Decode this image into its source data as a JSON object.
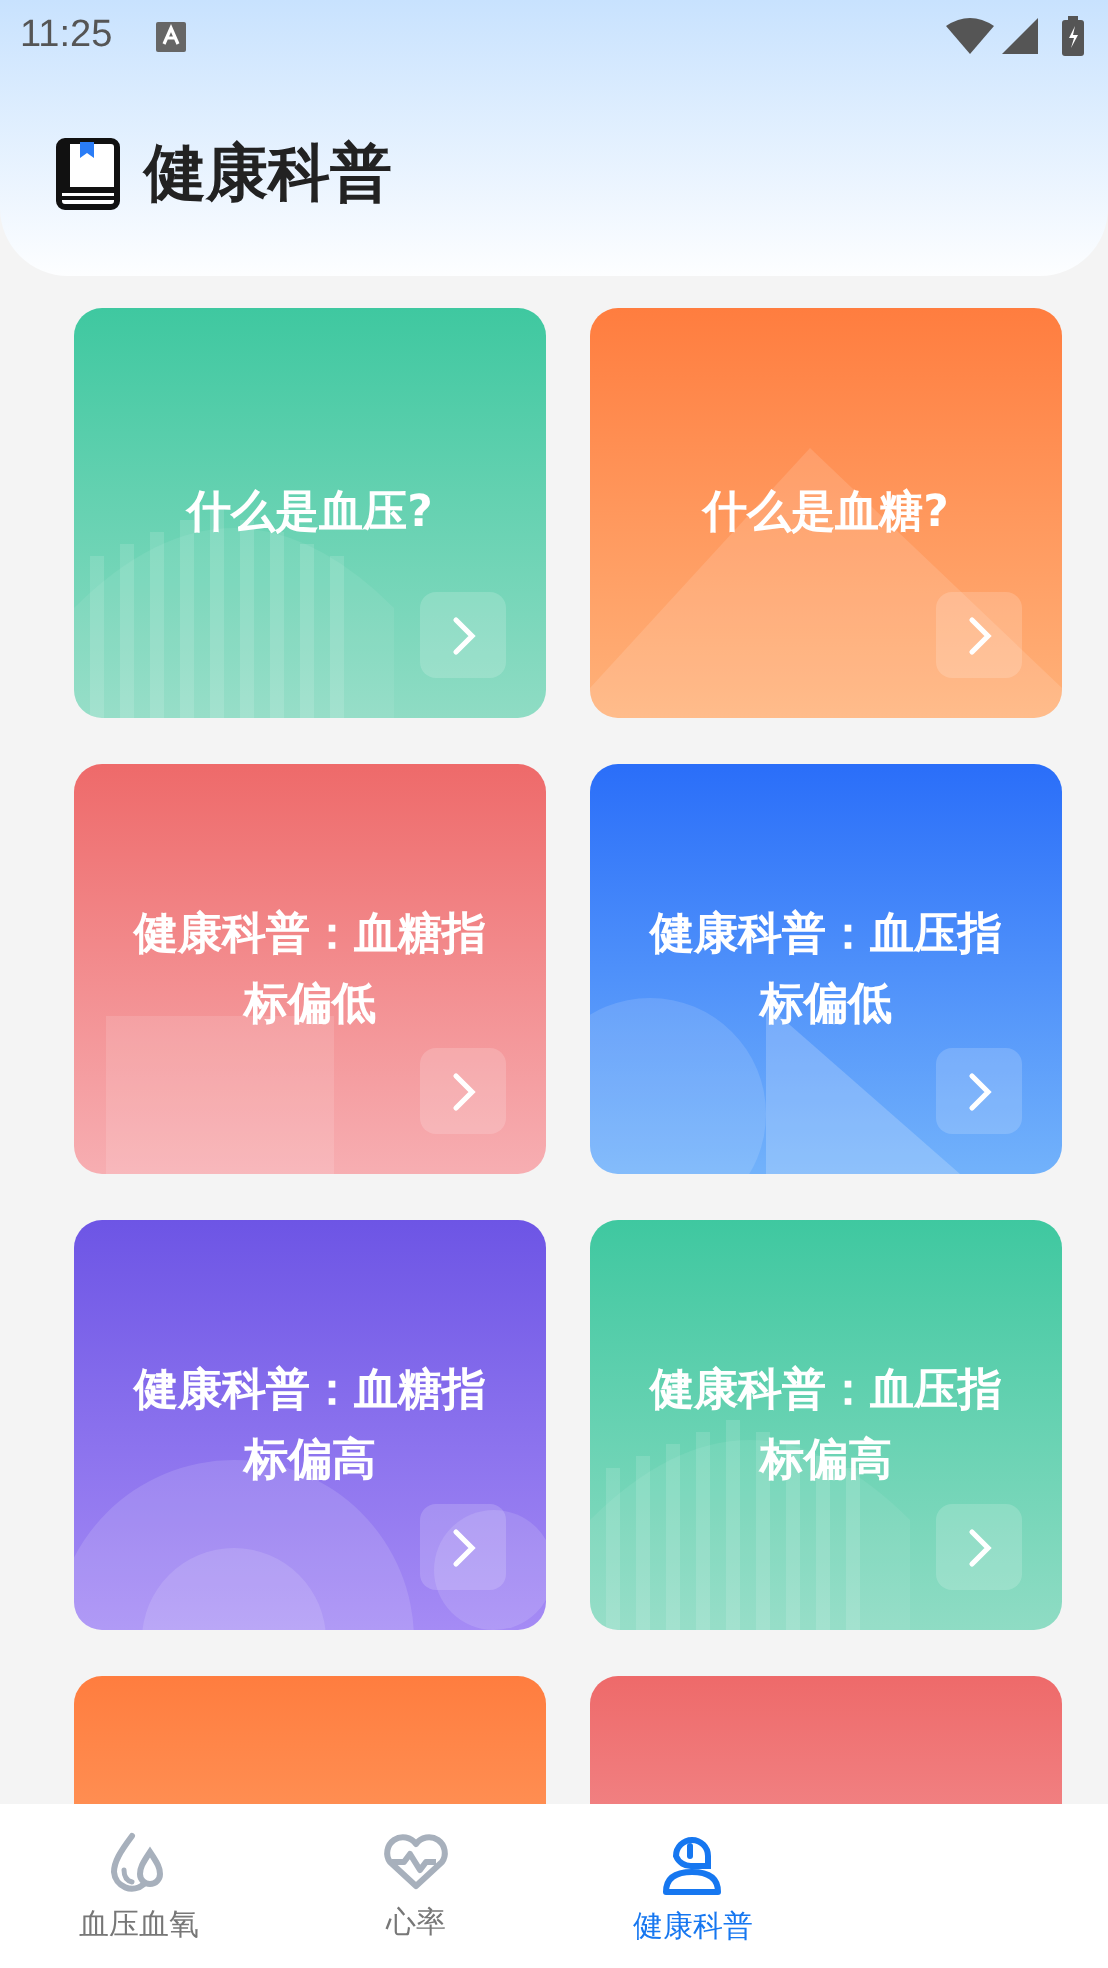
{
  "status_bar": {
    "time": "11:25"
  },
  "header": {
    "title": "健康科普"
  },
  "cards": [
    {
      "title": "什么是血压?",
      "kind": "stripes"
    },
    {
      "title": "什么是血糖?",
      "kind": "mountain"
    },
    {
      "title": "健康科普：血糖指标偏低",
      "kind": "square"
    },
    {
      "title": "健康科普：血压指标偏低",
      "kind": "triangle"
    },
    {
      "title": "健康科普：血糖指标偏高",
      "kind": "rings"
    },
    {
      "title": "健康科普：血压指标偏高",
      "kind": "stripes"
    },
    {
      "kind": "orange"
    },
    {
      "kind": "red"
    }
  ],
  "nav": [
    {
      "label": "血压血氧",
      "selected": false
    },
    {
      "label": "心率",
      "selected": false
    },
    {
      "label": "健康科普",
      "selected": true
    }
  ]
}
